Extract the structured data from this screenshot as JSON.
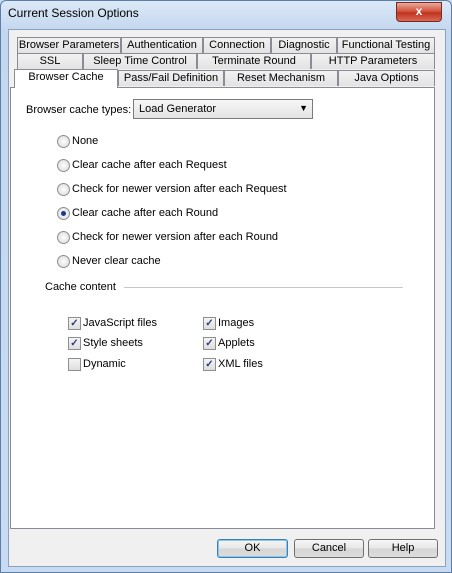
{
  "window": {
    "title": "Current Session Options",
    "close_glyph": "x"
  },
  "tabs_row1": [
    "Browser Parameters",
    "Authentication",
    "Connection",
    "Diagnostic",
    "Functional Testing"
  ],
  "tabs_row2": [
    "SSL",
    "Sleep Time Control",
    "Terminate Round",
    "HTTP Parameters"
  ],
  "tabs_row3": [
    "Browser Cache",
    "Pass/Fail Definition",
    "Reset Mechanism",
    "Java Options"
  ],
  "active_tab": "Browser Cache",
  "cache_types": {
    "label": "Browser cache types:",
    "selected": "Load Generator"
  },
  "radios": [
    {
      "label": "None",
      "selected": false
    },
    {
      "label": "Clear cache after each Request",
      "selected": false
    },
    {
      "label": "Check for newer version after each Request",
      "selected": false
    },
    {
      "label": "Clear cache after each Round",
      "selected": true
    },
    {
      "label": "Check for newer version after each Round",
      "selected": false
    },
    {
      "label": "Never clear cache",
      "selected": false
    }
  ],
  "cache_content": {
    "label": "Cache content",
    "items": [
      {
        "label": "JavaScript files",
        "checked": true
      },
      {
        "label": "Images",
        "checked": true
      },
      {
        "label": "Style sheets",
        "checked": true
      },
      {
        "label": "Applets",
        "checked": true
      },
      {
        "label": "Dynamic",
        "checked": false
      },
      {
        "label": "XML files",
        "checked": true
      }
    ]
  },
  "buttons": {
    "ok": "OK",
    "cancel": "Cancel",
    "help": "Help"
  },
  "check_glyph": "✓",
  "colors": {
    "close": "#c03320",
    "radio_dot": "#1a3a8a",
    "title_bar": "#c3d7ef"
  }
}
